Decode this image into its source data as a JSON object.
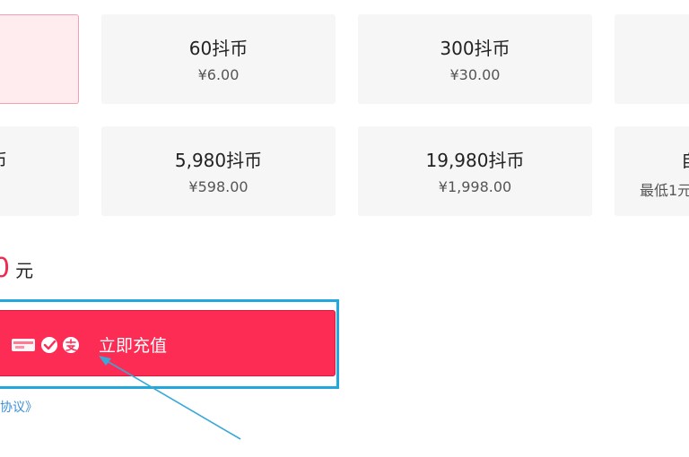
{
  "recharge_options": [
    {
      "coins": "",
      "price": ""
    },
    {
      "coins": "60抖币",
      "price": "¥6.00"
    },
    {
      "coins": "300抖币",
      "price": "¥30.00"
    },
    {
      "coins": "",
      "price": ""
    },
    {
      "coins": "币",
      "price": ""
    },
    {
      "coins": "5,980抖币",
      "price": "¥598.00"
    },
    {
      "coins": "19,980抖币",
      "price": "¥1,998.00"
    },
    {
      "coins": "自",
      "price": "最低1元"
    }
  ],
  "total": {
    "amount": "0",
    "unit": "元"
  },
  "pay_button": {
    "label": "立即充值",
    "icons": [
      "unionpay-icon",
      "wechat-pay-icon",
      "alipay-icon"
    ],
    "color": "#fc2c55"
  },
  "agreement": {
    "text": "协议》"
  },
  "colors": {
    "accent": "#fc2c55",
    "highlight": "#1fa7de",
    "link": "#3a8ed6"
  }
}
